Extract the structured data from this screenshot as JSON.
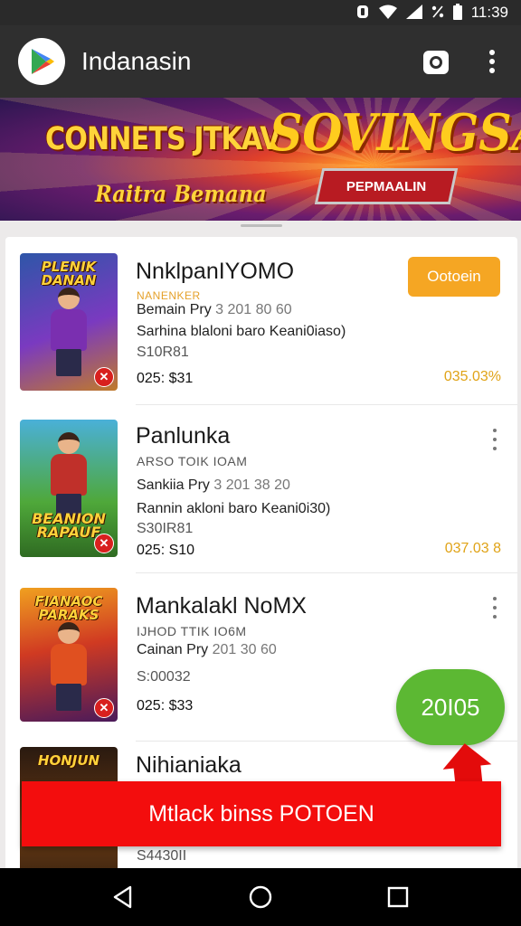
{
  "status_bar": {
    "time": "11:39",
    "icons": [
      "nfc-icon",
      "wifi-icon",
      "signal-icon",
      "vibrate-icon",
      "battery-icon"
    ]
  },
  "app_bar": {
    "title": "Indanasin",
    "logo": "play-store-logo",
    "actions": [
      "camera-icon",
      "more-vert-icon"
    ]
  },
  "banner": {
    "line1": "CONNETS JTKAV",
    "line2": "Raitra Bemana",
    "title": "SOVINGSA",
    "tag": "PEPMAALIN"
  },
  "games": [
    {
      "title": "NnklpanIYOMO",
      "cover_text": "PLENIK DANAN",
      "badge": "✕",
      "sub1": "NANENKER",
      "meta1": "Bemain Pry",
      "meta1_faint": "3 201 80 60",
      "meta2": "Sarhina blaloni  baro Keani0iaso)",
      "meta3": "S10R81",
      "price": "025: $31",
      "rating": "035.03%",
      "action_label": "Ootoein"
    },
    {
      "title": "Panlunka",
      "cover_text": "BEANION RAPAUF",
      "badge": "✕",
      "sub1": "ARSO TOIK IOAM",
      "meta1": "Sankiia Pry",
      "meta1_faint": "3 201 38 20",
      "meta2": "Rannin akloni  baro Keani0i30)",
      "meta3": "S30IR81",
      "price": "025: S10",
      "rating": "037.03 8"
    },
    {
      "title": "Mankalakl NoMX",
      "cover_text": "FIANAOC PARAKS",
      "badge": "✕",
      "sub1": "IJHOD TTIK IO6M",
      "meta1": "Cainan Pry",
      "meta1_faint": "201 30 60",
      "meta2": "",
      "meta3": "S:00032",
      "price": "025: $33",
      "rating": ""
    },
    {
      "title": "Nihianiaka",
      "cover_text": "HONJUN",
      "badge": "",
      "sub1": "",
      "meta1": "",
      "meta1_faint": "",
      "meta2": "",
      "meta3": "S4430II",
      "price": "",
      "rating": ""
    }
  ],
  "fab": {
    "label": "20I05",
    "color": "#5cb833"
  },
  "promo": {
    "label": "Mtlack binss POTOEN",
    "color": "#f30d0d"
  },
  "nav_bar": {
    "buttons": [
      "back-icon",
      "home-icon",
      "recents-icon"
    ]
  },
  "colors": {
    "accent_orange": "#f5a623",
    "rating_gold": "#e0a317",
    "app_bar": "#2f2f2f"
  }
}
